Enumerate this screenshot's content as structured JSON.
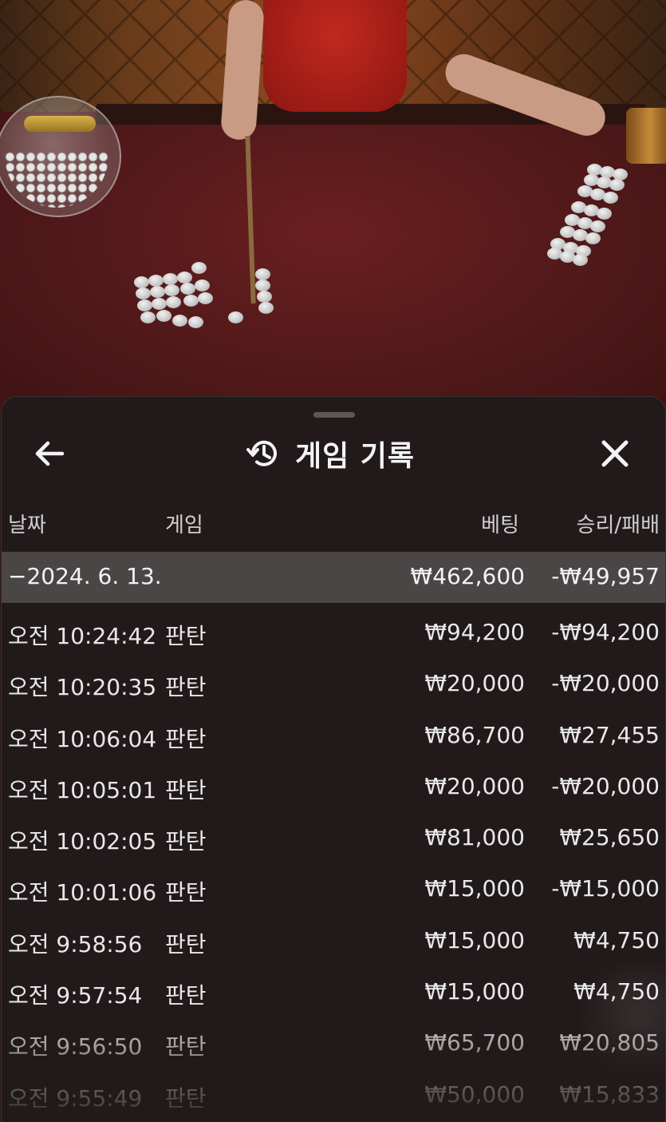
{
  "sheet": {
    "title": "게임 기록",
    "back_icon": "arrow-left-icon",
    "history_icon": "history-clock-icon",
    "close_icon": "close-icon"
  },
  "columns": {
    "date": "날짜",
    "game": "게임",
    "bet": "베팅",
    "win_loss": "승리/패배"
  },
  "date_group": {
    "toggle": "−",
    "date": "2024. 6. 13.",
    "bet_total": "₩462,600",
    "win_loss_total": "-₩49,957"
  },
  "rows": [
    {
      "time": "오전 10:24:42",
      "game": "판탄",
      "bet": "₩94,200",
      "win_loss": "-₩94,200"
    },
    {
      "time": "오전 10:20:35",
      "game": "판탄",
      "bet": "₩20,000",
      "win_loss": "-₩20,000"
    },
    {
      "time": "오전 10:06:04",
      "game": "판탄",
      "bet": "₩86,700",
      "win_loss": "₩27,455"
    },
    {
      "time": "오전 10:05:01",
      "game": "판탄",
      "bet": "₩20,000",
      "win_loss": "-₩20,000"
    },
    {
      "time": "오전 10:02:05",
      "game": "판탄",
      "bet": "₩81,000",
      "win_loss": "₩25,650"
    },
    {
      "time": "오전 10:01:06",
      "game": "판탄",
      "bet": "₩15,000",
      "win_loss": "-₩15,000"
    },
    {
      "time": "오전 9:58:56",
      "game": "판탄",
      "bet": "₩15,000",
      "win_loss": "₩4,750"
    },
    {
      "time": "오전 9:57:54",
      "game": "판탄",
      "bet": "₩15,000",
      "win_loss": "₩4,750"
    },
    {
      "time": "오전 9:56:50",
      "game": "판탄",
      "bet": "₩65,700",
      "win_loss": "₩20,805"
    },
    {
      "time": "오전 9:55:49",
      "game": "판탄",
      "bet": "₩50,000",
      "win_loss": "₩15,833"
    }
  ],
  "colors": {
    "sheet_bg": "#221a1a",
    "date_row_bg": "#4b4646",
    "text": "#e8e8e8",
    "felt": "#561a1b"
  }
}
